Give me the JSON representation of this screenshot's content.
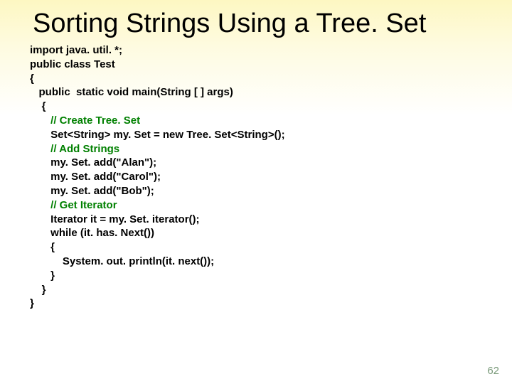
{
  "title": "Sorting Strings Using a Tree. Set",
  "code": {
    "l0": "import java. util. *;",
    "l1": "public class Test",
    "l2": "{",
    "l3": "   public  static void main(String [ ] args)",
    "l4": "    {",
    "c1": "       // Create Tree. Set",
    "l5": "       Set<String> my. Set = new Tree. Set<String>();",
    "c2": "       // Add Strings",
    "l6": "       my. Set. add(\"Alan\");",
    "l7": "       my. Set. add(\"Carol\");",
    "l8": "       my. Set. add(\"Bob\");",
    "c3": "       // Get Iterator",
    "l9": "       Iterator it = my. Set. iterator();",
    "l10": "       while (it. has. Next())",
    "l11": "       {",
    "l12": "           System. out. println(it. next());",
    "l13": "       }",
    "l14": "    }",
    "l15": "}"
  },
  "pagenum": "62"
}
